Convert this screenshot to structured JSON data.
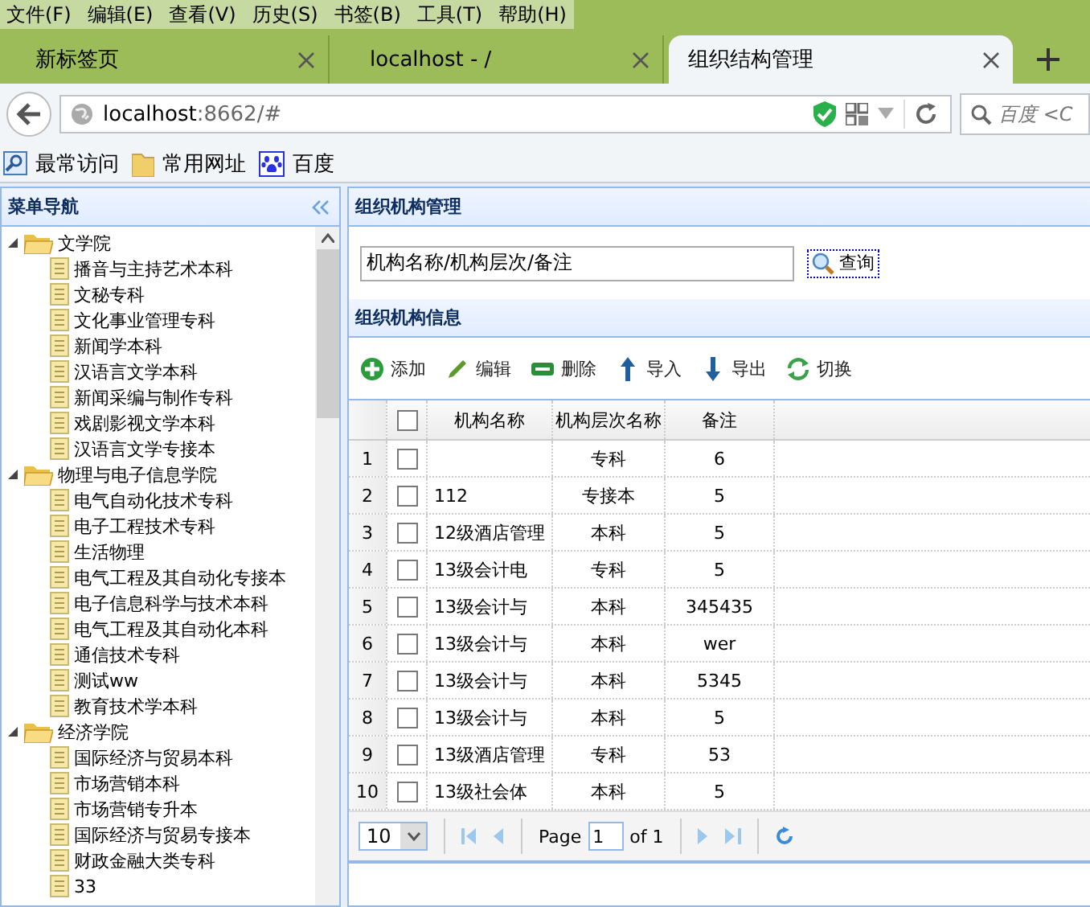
{
  "menu_bar": [
    "文件(F)",
    "编辑(E)",
    "查看(V)",
    "历史(S)",
    "书签(B)",
    "工具(T)",
    "帮助(H)"
  ],
  "tabs": [
    {
      "label": "新标签页",
      "selected": false
    },
    {
      "label": "localhost - /",
      "selected": false
    },
    {
      "label": "组织结构管理",
      "selected": true
    }
  ],
  "address_bar": {
    "host": "localhost",
    "rest": ":8662/#"
  },
  "search": {
    "placeholder": "百度 <C"
  },
  "bookmarks": [
    {
      "label": "最常访问",
      "kind": "search"
    },
    {
      "label": "常用网址",
      "kind": "folder"
    },
    {
      "label": "百度",
      "kind": "paw"
    }
  ],
  "sidebar": {
    "title": "菜单导航",
    "items": [
      {
        "label": "文学院",
        "expanded": true,
        "children": [
          {
            "label": "播音与主持艺术本科"
          },
          {
            "label": "文秘专科"
          },
          {
            "label": "文化事业管理专科"
          },
          {
            "label": "新闻学本科"
          },
          {
            "label": "汉语言文学本科"
          },
          {
            "label": "新闻采编与制作专科"
          },
          {
            "label": "戏剧影视文学本科"
          },
          {
            "label": "汉语言文学专接本"
          }
        ]
      },
      {
        "label": "物理与电子信息学院",
        "expanded": true,
        "children": [
          {
            "label": "电气自动化技术专科"
          },
          {
            "label": "电子工程技术专科"
          },
          {
            "label": "生活物理"
          },
          {
            "label": "电气工程及其自动化专接本"
          },
          {
            "label": "电子信息科学与技术本科"
          },
          {
            "label": "电气工程及其自动化本科"
          },
          {
            "label": "通信技术专科"
          },
          {
            "label": "测试ww"
          },
          {
            "label": "教育技术学本科"
          }
        ]
      },
      {
        "label": "经济学院",
        "expanded": true,
        "children": [
          {
            "label": "国际经济与贸易本科"
          },
          {
            "label": "市场营销本科"
          },
          {
            "label": "市场营销专升本"
          },
          {
            "label": "国际经济与贸易专接本"
          },
          {
            "label": "财政金融大类专科"
          },
          {
            "label": "33"
          }
        ]
      }
    ]
  },
  "search_panel": {
    "title": "组织机构管理",
    "query": "机构名称/机构层次/备注",
    "button": "查询"
  },
  "grid": {
    "title": "组织机构信息",
    "toolbar": [
      {
        "label": "添加",
        "kind": "add"
      },
      {
        "label": "编辑",
        "kind": "edit"
      },
      {
        "label": "删除",
        "kind": "delete"
      },
      {
        "label": "导入",
        "kind": "import"
      },
      {
        "label": "导出",
        "kind": "export"
      },
      {
        "label": "切换",
        "kind": "switch"
      }
    ],
    "select_all_checked": false,
    "columns": [
      "机构名称",
      "机构层次名称",
      "备注"
    ],
    "rows": [
      {
        "num": "1",
        "checked": false,
        "cells": [
          "",
          "专科",
          "6"
        ]
      },
      {
        "num": "2",
        "checked": false,
        "cells": [
          "112",
          "专接本",
          "5"
        ]
      },
      {
        "num": "3",
        "checked": false,
        "cells": [
          "12级酒店管理",
          "本科",
          "5"
        ]
      },
      {
        "num": "4",
        "checked": false,
        "cells": [
          "13级会计电",
          "专科",
          "5"
        ]
      },
      {
        "num": "5",
        "checked": false,
        "cells": [
          "13级会计与",
          "本科",
          "345435"
        ]
      },
      {
        "num": "6",
        "checked": false,
        "cells": [
          "13级会计与",
          "本科",
          "wer"
        ]
      },
      {
        "num": "7",
        "checked": false,
        "cells": [
          "13级会计与",
          "本科",
          "5345"
        ]
      },
      {
        "num": "8",
        "checked": false,
        "cells": [
          "13级会计与",
          "本科",
          "5"
        ]
      },
      {
        "num": "9",
        "checked": false,
        "cells": [
          "13级酒店管理",
          "专科",
          "53"
        ]
      },
      {
        "num": "10",
        "checked": false,
        "cells": [
          "13级社会体",
          "本科",
          "5"
        ]
      }
    ],
    "pager": {
      "page_size": "10",
      "page_label": "Page",
      "page": "1",
      "of_label": "of 1"
    }
  }
}
